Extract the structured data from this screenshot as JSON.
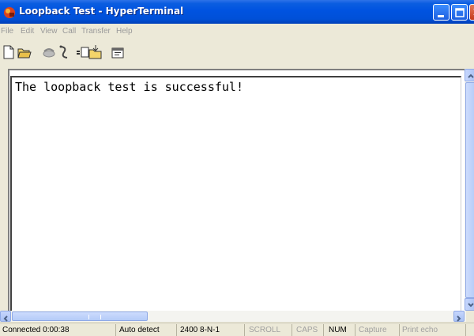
{
  "window": {
    "title": "Loopback Test - HyperTerminal"
  },
  "menu": [
    "File",
    "Edit",
    "View",
    "Call",
    "Transfer",
    "Help"
  ],
  "toolbar": {
    "icons": [
      "new-icon",
      "open-icon",
      "dial-icon",
      "disconnect-icon",
      "send-icon",
      "receive-icon",
      "properties-icon"
    ]
  },
  "terminal": {
    "line1": "The loopback test is successful!"
  },
  "statusbar": {
    "connected": "Connected 0:00:38",
    "detect": "Auto detect",
    "settings": "2400 8-N-1",
    "scroll": "SCROLL",
    "caps": "CAPS",
    "num": "NUM",
    "capture": "Capture",
    "print_echo": "Print echo"
  },
  "colors": {
    "titlebar": "#0053e0",
    "accent_close": "#c4391a"
  }
}
